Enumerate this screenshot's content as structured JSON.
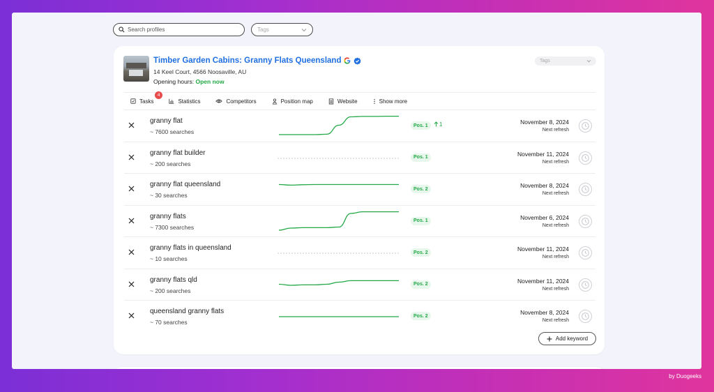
{
  "search": {
    "placeholder": "Search profiles"
  },
  "tags_filter": {
    "placeholder": "Tags"
  },
  "profile": {
    "name": "Timber Garden Cabins: Granny Flats Queensland",
    "address": "14 Keel Court, 4566 Noosaville, AU",
    "hours_label": "Opening hours:",
    "hours_status": "Open now",
    "tags_placeholder": "Tags"
  },
  "tabs": [
    {
      "label": "Tasks",
      "icon": "checkbox-icon",
      "badge": "4"
    },
    {
      "label": "Statistics",
      "icon": "bar-chart-icon"
    },
    {
      "label": "Competitors",
      "icon": "eye-icon"
    },
    {
      "label": "Position map",
      "icon": "map-pin-person-icon"
    },
    {
      "label": "Website",
      "icon": "page-icon"
    },
    {
      "label": "Show more",
      "icon": "more-vertical-icon"
    }
  ],
  "keywords": [
    {
      "keyword": "granny flat",
      "searches": "~ 7600 searches",
      "position": "Pos. 1",
      "change": "1",
      "date": "November 8, 2024",
      "next": "Next refresh",
      "trend": [
        0.1,
        0.1,
        0.1,
        0.1,
        0.12,
        0.55,
        0.95,
        0.97,
        0.97,
        0.98,
        0.98
      ],
      "flat": false
    },
    {
      "keyword": "granny flat builder",
      "searches": "~ 200 searches",
      "position": "Pos. 1",
      "change": "",
      "date": "November 11, 2024",
      "next": "Next refresh",
      "trend": [],
      "flat": true
    },
    {
      "keyword": "granny flat queensland",
      "searches": "~ 30 searches",
      "position": "Pos. 2",
      "change": "",
      "date": "November 8, 2024",
      "next": "Next refresh",
      "trend": [
        0.75,
        0.72,
        0.74,
        0.75,
        0.75,
        0.75,
        0.75,
        0.75,
        0.75,
        0.75,
        0.75
      ],
      "flat": false
    },
    {
      "keyword": "granny flats",
      "searches": "~ 7300 searches",
      "position": "Pos. 1",
      "change": "",
      "date": "November 6, 2024",
      "next": "Next refresh",
      "trend": [
        0.1,
        0.2,
        0.22,
        0.22,
        0.22,
        0.25,
        0.9,
        0.98,
        0.98,
        0.98,
        0.98
      ],
      "flat": false
    },
    {
      "keyword": "granny flats in queensland",
      "searches": "~ 10 searches",
      "position": "Pos. 2",
      "change": "",
      "date": "November 11, 2024",
      "next": "Next refresh",
      "trend": [],
      "flat": true
    },
    {
      "keyword": "granny flats qld",
      "searches": "~ 200 searches",
      "position": "Pos. 2",
      "change": "",
      "date": "November 11, 2024",
      "next": "Next refresh",
      "trend": [
        0.55,
        0.5,
        0.52,
        0.52,
        0.55,
        0.65,
        0.72,
        0.72,
        0.72,
        0.72,
        0.72
      ],
      "flat": false
    },
    {
      "keyword": "queensland granny flats",
      "searches": "~ 70 searches",
      "position": "Pos. 2",
      "change": "",
      "date": "November 8, 2024",
      "next": "Next refresh",
      "trend": [
        0.5,
        0.5,
        0.5,
        0.5,
        0.5,
        0.5,
        0.5,
        0.5,
        0.5,
        0.5,
        0.5
      ],
      "flat": false
    }
  ],
  "add_keyword_label": "Add keyword",
  "credit": "by Duogeeks",
  "colors": {
    "accent": "#1f6fe0",
    "success": "#22a846",
    "badge": "#e84c4c"
  }
}
